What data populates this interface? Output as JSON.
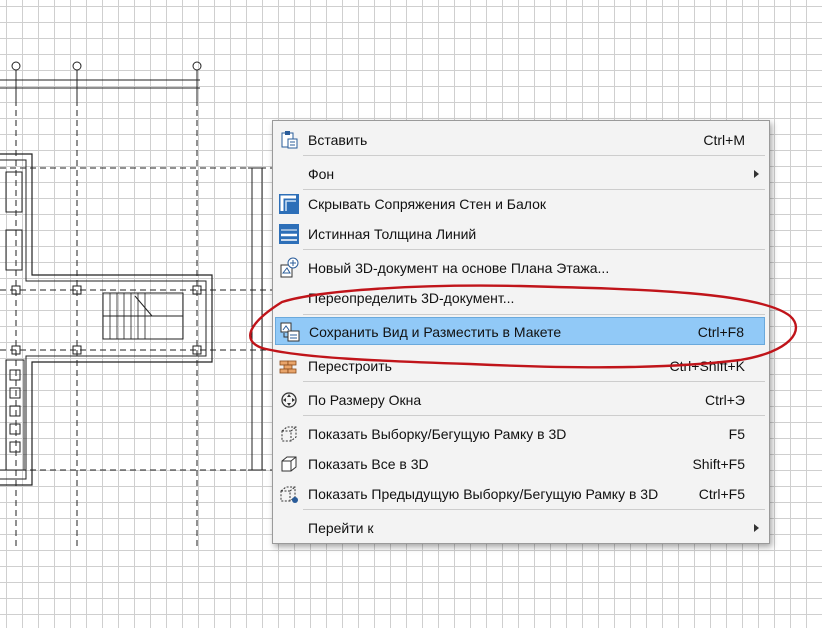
{
  "menu": {
    "items": [
      {
        "label": "Вставить",
        "shortcut": "Ctrl+M",
        "icon": "paste-icon"
      },
      {
        "label": "Фон",
        "shortcut": "",
        "icon": "",
        "submenu": true
      },
      {
        "label": "Скрывать Сопряжения Стен и Балок",
        "shortcut": "",
        "icon": "wall-beam-junction-icon"
      },
      {
        "label": "Истинная Толщина Линий",
        "shortcut": "",
        "icon": "true-line-weight-icon"
      },
      {
        "label": "Новый 3D-документ на основе Плана Этажа...",
        "shortcut": "",
        "icon": "new-3d-document-icon"
      },
      {
        "label": "Переопределить 3D-документ...",
        "shortcut": "",
        "icon": ""
      },
      {
        "label": "Сохранить Вид и Разместить в Макете",
        "shortcut": "Ctrl+F8",
        "icon": "save-view-place-layout-icon"
      },
      {
        "label": "Перестроить",
        "shortcut": "Ctrl+Shift+K",
        "icon": "rebuild-icon"
      },
      {
        "label": "По Размеру Окна",
        "shortcut": "Ctrl+Э",
        "icon": "fit-in-window-icon"
      },
      {
        "label": "Показать Выборку/Бегущую Рамку в 3D",
        "shortcut": "F5",
        "icon": "show-selection-3d-icon"
      },
      {
        "label": "Показать Все в 3D",
        "shortcut": "Shift+F5",
        "icon": "show-all-3d-icon"
      },
      {
        "label": "Показать Предыдущую Выборку/Бегущую Рамку в 3D",
        "shortcut": "Ctrl+F5",
        "icon": "show-previous-selection-3d-icon"
      },
      {
        "label": "Перейти к",
        "shortcut": "",
        "icon": "",
        "submenu": true
      }
    ],
    "selected_index": 6
  },
  "colors": {
    "highlight": "#91c9f7",
    "annotation": "#c0141a",
    "grid": "#cfcfcf"
  }
}
